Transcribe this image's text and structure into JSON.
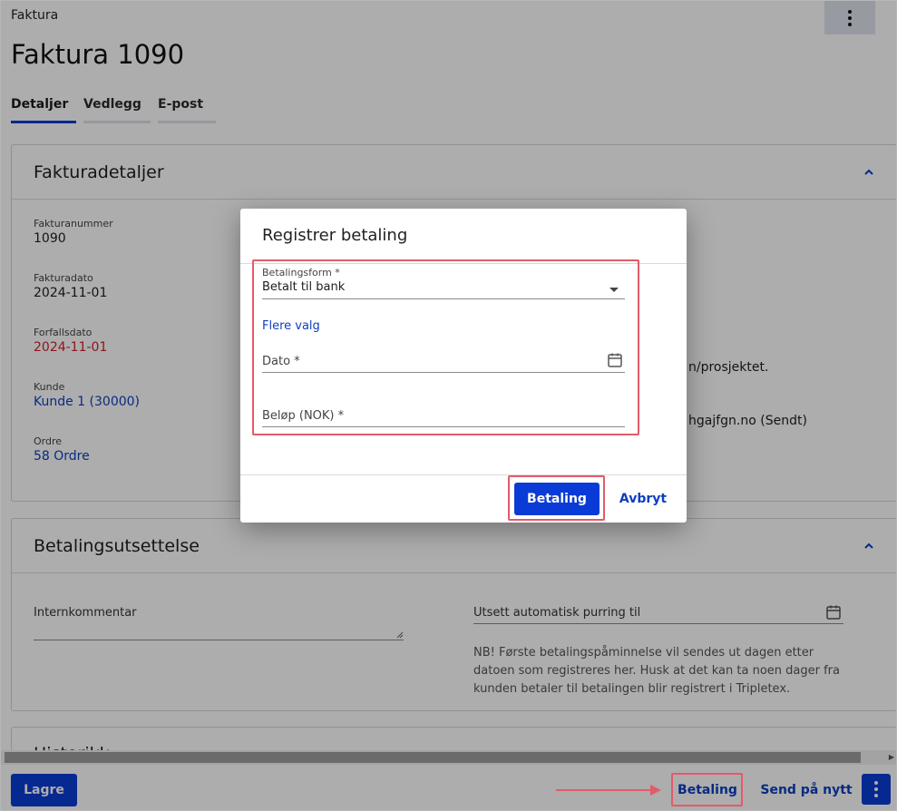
{
  "breadcrumb": "Faktura",
  "page_title": "Faktura 1090",
  "tabs": [
    {
      "label": "Detaljer",
      "active": true
    },
    {
      "label": "Vedlegg",
      "active": false
    },
    {
      "label": "E-post",
      "active": false
    }
  ],
  "details_card": {
    "title": "Fakturadetaljer",
    "fields": [
      {
        "label": "Fakturanummer",
        "value": "1090"
      },
      {
        "label": "Fakturadato",
        "value": "2024-11-01"
      },
      {
        "label": "Forfallsdato",
        "value": "2024-11-01"
      },
      {
        "label": "Kunde",
        "value": "Kunde 1 (30000)"
      },
      {
        "label": "Ordre",
        "value": "58 Ordre"
      }
    ],
    "partial_right_1": "n/prosjektet.",
    "partial_right_2": "hgajfgn.no (Sendt)"
  },
  "deferral_card": {
    "title": "Betalingsutsettelse",
    "internal_comment_label": "Internkommentar",
    "defer_label": "Utsett automatisk purring til",
    "note": "NB! Første betalingspåminnelse vil sendes ut dagen etter datoen som registreres her. Husk at det kan ta noen dager fra kunden betaler til betalingen blir registrert i Tripletex."
  },
  "history_card": {
    "title": "Historikk"
  },
  "bottom_bar": {
    "save_label": "Lagre",
    "payment_label": "Betaling",
    "resend_label": "Send på nytt"
  },
  "dialog": {
    "title": "Registrer betaling",
    "payment_method_label": "Betalingsform *",
    "payment_method_value": "Betalt til bank",
    "more_options_label": "Flere valg",
    "date_placeholder": "Dato *",
    "amount_placeholder": "Beløp (NOK) *",
    "submit_label": "Betaling",
    "cancel_label": "Avbryt"
  },
  "colors": {
    "primary": "#0a3bd6",
    "link": "#0c3fbf",
    "danger_text": "#d11f2f",
    "highlight": "#e25b6a"
  }
}
